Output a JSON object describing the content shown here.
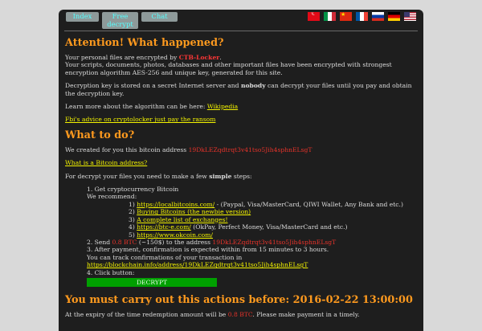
{
  "nav": {
    "tabs": [
      "Index",
      "Free decrypt",
      "Chat"
    ]
  },
  "flags": [
    "turkey-flag-icon",
    "italy-flag-icon",
    "china-flag-icon",
    "france-flag-icon",
    "russia-flag-icon",
    "germany-flag-icon",
    "usa-flag-icon"
  ],
  "section1": {
    "title": "Attention! What happened?",
    "p1_a": "Your personal files are encrypted by ",
    "p1_brand": "CTB-Locker",
    "p1_b": ".",
    "p1_c": "Your scripts, documents, photos, databases and other important files have been encrypted with strongest encryption algorithm AES-256 and unique key, generated for this site.",
    "p2_a": "Decryption key is stored on a secret Internet server and ",
    "p2_bold": "nobody",
    "p2_b": " can decrypt your files until you pay and obtain the decryption key.",
    "p3": "Learn more about the algorithm can be here: ",
    "p3_link": "Wikipedia",
    "fbi_link": "Fbi's advice on cryptolocker just pay the ransom"
  },
  "section2": {
    "title": "What to do?",
    "address_intro": "We created for you this bitcoin address ",
    "address": "19DkLEZqdtrqt3v41tso5Jih4sphnELsgT",
    "bitcoin_link": "What is a Bitcoin address?",
    "steps_a": "For decrypt your files you need to make a few ",
    "steps_bold": "simple",
    "steps_b": " steps:",
    "step1": "1. Get cryptocurrency Bitcoin",
    "recommend": "We recommend:",
    "ex1_num": "1) ",
    "ex1_link": "https://localbitcoins.com/",
    "ex1_rest": " - (Paypal, Visa/MasterCard, QIWI Wallet, Any Bank and etc.)",
    "ex2_num": "2) ",
    "ex2_link": "Buying Bitcoins (the newbie version)",
    "ex3_num": "3) ",
    "ex3_link": "A complete list of exchanges!",
    "ex4_num": "4) ",
    "ex4_link": "https://btc-e.com/",
    "ex4_rest": " (OkPay, Perfect Money, Visa/MasterCard and etc.)",
    "ex5_num": "5) ",
    "ex5_link": "https://www.okcoin.com/",
    "step2_a": "2. Send ",
    "step2_amount": "0.8 BTC",
    "step2_b": " (~150$) to the address ",
    "step3": "3. After payment, confirmation is expected within from 15 minutes to 3 hours.",
    "track": "You can track confirmations of your transaction in",
    "track_link": "https://blockchain.info/address/19DkLEZqdtrqt3v41tso5Jih4sphnELsgT",
    "step4": "4. Click button:",
    "decrypt": "DECRYPT"
  },
  "section3": {
    "title": "You must carry out this actions before: 2016-02-22 13:00:00",
    "expiry_a": "At the expiry of the time redemption amount will be ",
    "expiry_amount": "0.8 BTC",
    "expiry_b": ". Please make payment in a timely."
  }
}
